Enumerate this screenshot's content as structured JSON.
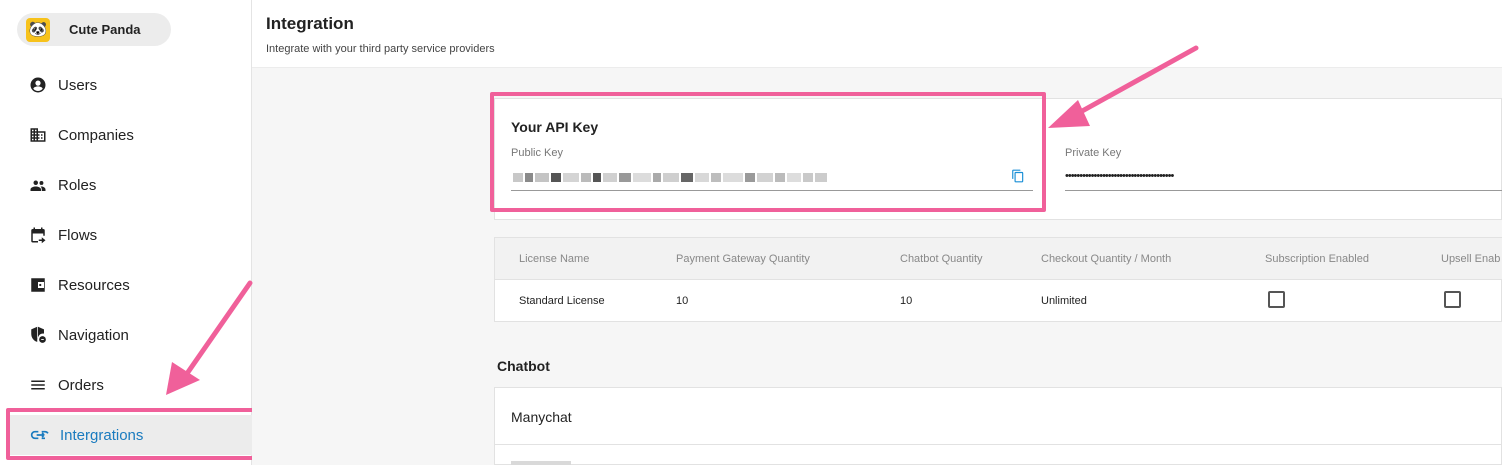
{
  "sidebar": {
    "org": {
      "name": "Cute Panda",
      "logo": "panda-logo"
    },
    "items": [
      {
        "label": "Users",
        "icon": "account-circle-icon"
      },
      {
        "label": "Companies",
        "icon": "building-icon"
      },
      {
        "label": "Roles",
        "icon": "people-icon"
      },
      {
        "label": "Flows",
        "icon": "calendar-flow-icon"
      },
      {
        "label": "Resources",
        "icon": "wallet-icon"
      },
      {
        "label": "Navigation",
        "icon": "shield-icon"
      },
      {
        "label": "Orders",
        "icon": "list-icon"
      },
      {
        "label": "Intergrations",
        "icon": "link-icon",
        "active": true
      }
    ]
  },
  "header": {
    "title": "Integration",
    "subtitle": "Integrate with your third party service providers"
  },
  "api_key": {
    "title": "Your API Key",
    "public_label": "Public Key",
    "private_label": "Private Key",
    "private_value": "••••••••••••••••••••••••••••••••••••••"
  },
  "license": {
    "columns": [
      "License Name",
      "Payment Gateway Quantity",
      "Chatbot Quantity",
      "Checkout Quantity / Month",
      "Subscription Enabled",
      "Upsell Enab"
    ],
    "row": {
      "name": "Standard License",
      "payment_gateway_quantity": "10",
      "chatbot_quantity": "10",
      "checkout_quantity": "Unlimited",
      "subscription_enabled": false,
      "upsell_enabled": false
    }
  },
  "chatbot": {
    "title": "Chatbot",
    "items": [
      "Manychat"
    ]
  },
  "colors": {
    "accent": "#1a7bbf",
    "highlight": "#f0609a",
    "logo": "#f7c21b"
  }
}
